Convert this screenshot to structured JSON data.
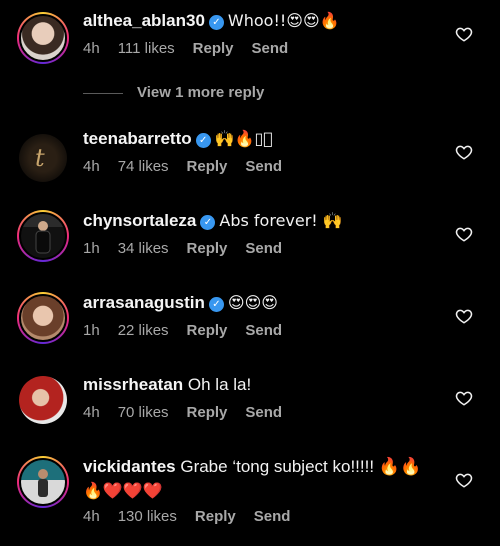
{
  "comments": [
    {
      "username": "althea_ablan30",
      "text": "Whoo!!😍😍🔥",
      "time": "4h",
      "likes": "111 likes",
      "reply": "Reply",
      "send": "Send"
    },
    {
      "username": "teenabarretto",
      "text": "🙌🔥▯🏻",
      "time": "4h",
      "likes": "74 likes",
      "reply": "Reply",
      "send": "Send"
    },
    {
      "username": "chynsortaleza",
      "text": "Abs forever! 🙌",
      "time": "1h",
      "likes": "34 likes",
      "reply": "Reply",
      "send": "Send"
    },
    {
      "username": "arrasanagustin",
      "text": "😍😍😍",
      "time": "1h",
      "likes": "22 likes",
      "reply": "Reply",
      "send": "Send"
    },
    {
      "username": "missrheatan",
      "text": "Oh la la!",
      "time": "4h",
      "likes": "70 likes",
      "reply": "Reply",
      "send": "Send"
    },
    {
      "username": "vickidantes",
      "text": "Grabe ‘tong subject ko!!!!! 🔥🔥",
      "text_line2": "🔥❤️❤️❤️",
      "time": "4h",
      "likes": "130 likes",
      "reply": "Reply",
      "send": "Send"
    }
  ],
  "view_more": "View 1 more reply",
  "colors": {
    "background": "#000000",
    "text": "#f5f5f5",
    "meta": "#a8a8a8",
    "verified": "#3897f0"
  },
  "icons": {
    "like": "heart-outline-icon",
    "verified": "verified-badge-icon"
  }
}
